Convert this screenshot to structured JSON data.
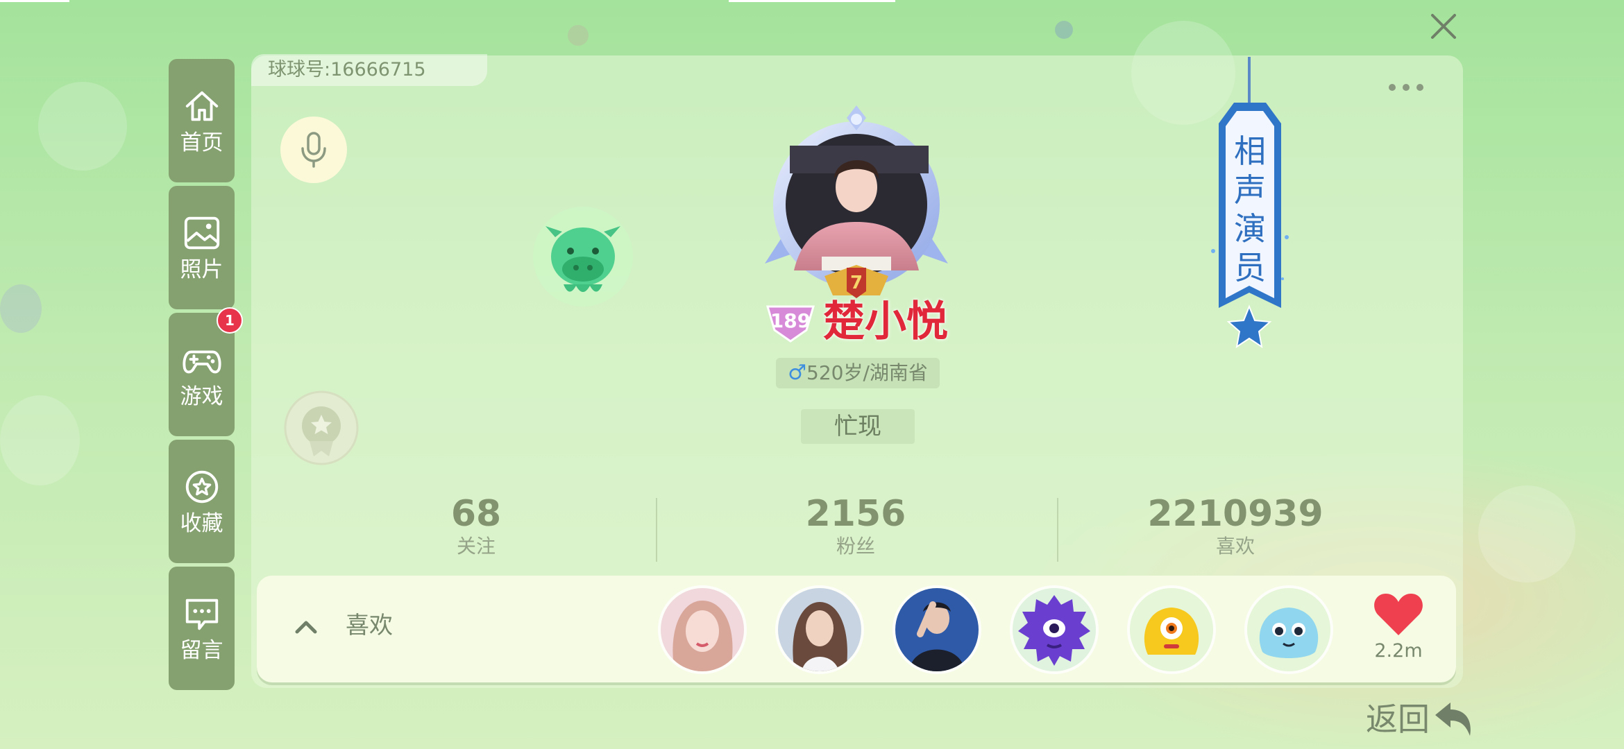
{
  "profile": {
    "ball_id": "球球号:16666715",
    "level": "189",
    "nickname": "楚小悦",
    "gender_symbol": "♂",
    "age_location": "520岁/湖南省",
    "status": "忙现",
    "frame_level": "7",
    "title_tag": [
      "相",
      "声",
      "演",
      "员"
    ]
  },
  "sidebar": {
    "items": [
      {
        "label": "首页",
        "icon": "home-icon"
      },
      {
        "label": "照片",
        "icon": "photo-icon"
      },
      {
        "label": "游戏",
        "icon": "gamepad-icon",
        "badge": "1"
      },
      {
        "label": "收藏",
        "icon": "star-icon"
      },
      {
        "label": "留言",
        "icon": "message-icon"
      }
    ]
  },
  "stats": [
    {
      "value": "68",
      "label": "关注"
    },
    {
      "value": "2156",
      "label": "粉丝"
    },
    {
      "value": "2210939",
      "label": "喜欢"
    }
  ],
  "likes": {
    "title": "喜欢",
    "count": "2.2m"
  },
  "footer": {
    "back_label": "返回"
  },
  "colors": {
    "accent_green": "#86a170",
    "nickname_red": "#e0283a",
    "heart_red": "#ef4050",
    "badge_red": "#e8344a"
  }
}
